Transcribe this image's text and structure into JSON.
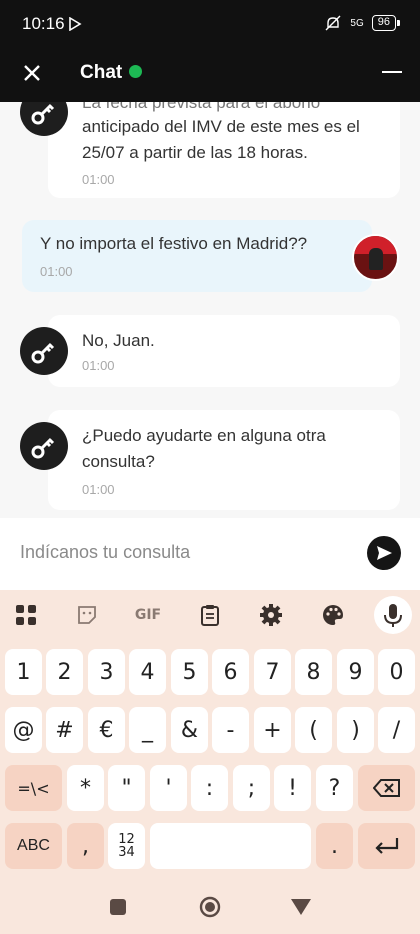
{
  "status_bar": {
    "time": "10:16",
    "network": "5G",
    "battery": "96"
  },
  "header": {
    "title": "Chat",
    "online_color": "#1db954"
  },
  "messages": [
    {
      "from": "bot",
      "text_partial": "La fecha prevista para el abono",
      "text_lines": [
        "anticipado del IMV de este mes es el",
        "25/07 a partir de las 18 horas."
      ],
      "time": "01:00"
    },
    {
      "from": "user",
      "text": "Y no importa el festivo en Madrid??",
      "time": "01:00"
    },
    {
      "from": "bot",
      "text": "No, Juan.",
      "time": "01:00"
    },
    {
      "from": "bot",
      "text_lines": [
        "¿Puedo ayudarte en alguna otra",
        "consulta?"
      ],
      "time": "01:00"
    }
  ],
  "input": {
    "placeholder": "Indícanos tu consulta"
  },
  "keyboard": {
    "toolbar": [
      "apps-icon",
      "sticker-icon",
      "gif-icon",
      "clipboard-icon",
      "settings-icon",
      "palette-icon",
      "mic-icon"
    ],
    "gif_label": "GIF",
    "row1": [
      "1",
      "2",
      "3",
      "4",
      "5",
      "6",
      "7",
      "8",
      "9",
      "0"
    ],
    "row2": [
      "@",
      "#",
      "€",
      "_",
      "&",
      "-",
      "+",
      "(",
      ")",
      "/"
    ],
    "row3": [
      "=\\<",
      "*",
      "\"",
      "'",
      ":",
      ";",
      "!",
      "?"
    ],
    "row4": {
      "abc": "ABC",
      "comma": ",",
      "numpad_top": "12",
      "numpad_bottom": "34",
      "period": "."
    }
  },
  "colors": {
    "dark": "#111111",
    "bubble_user": "#e9f5fb",
    "keyboard_bg": "#f9e7dd",
    "special_key": "#f6d3c3"
  }
}
